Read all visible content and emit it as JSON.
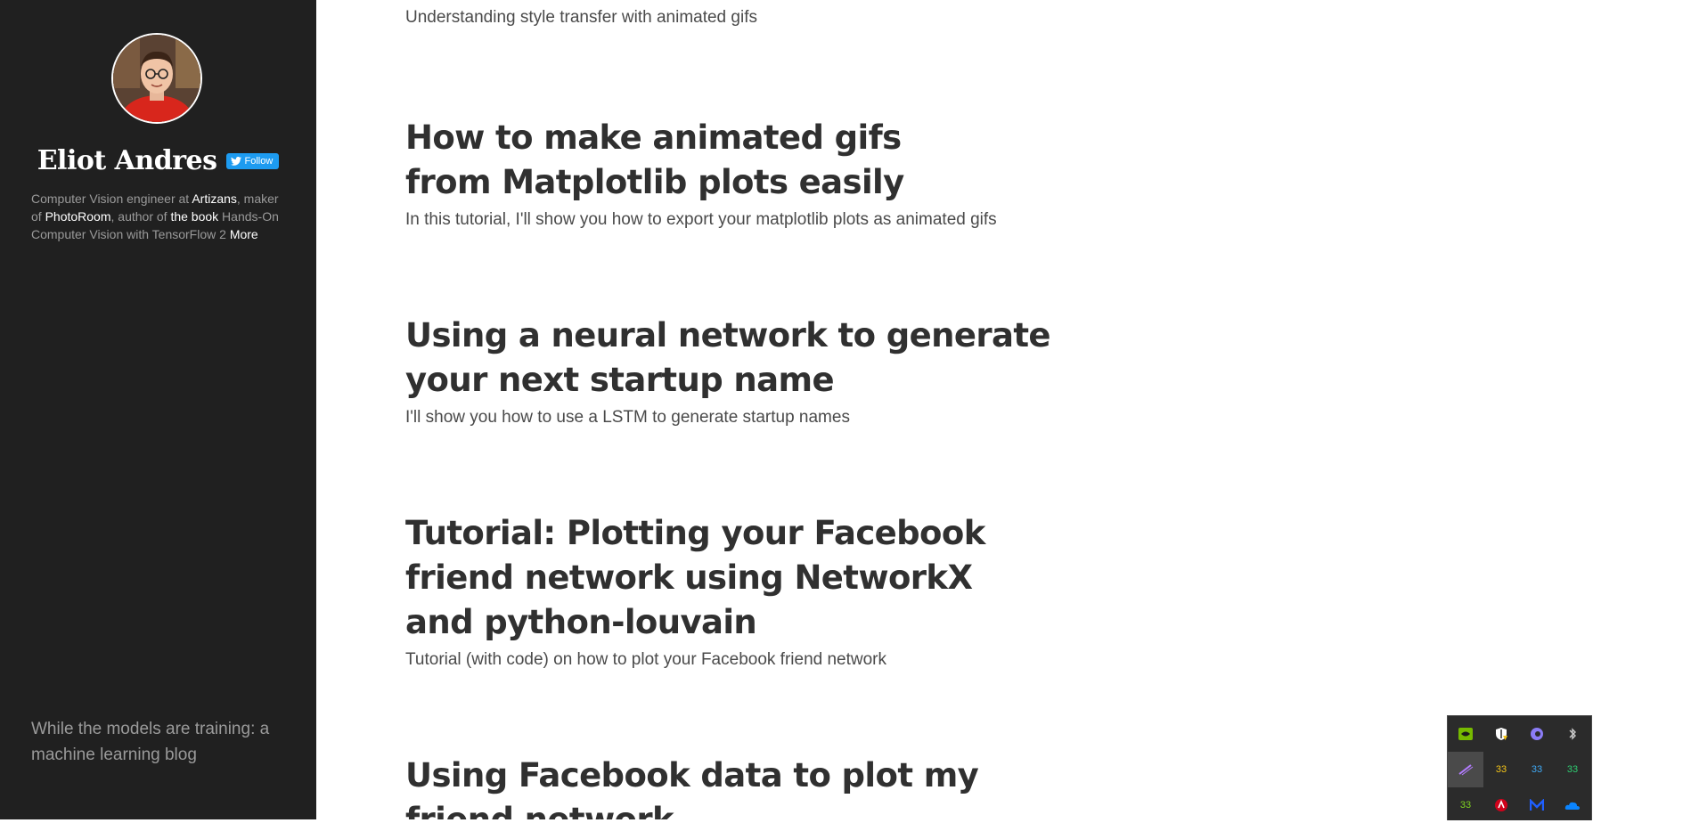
{
  "sidebar": {
    "author_name": "Eliot Andres",
    "follow_label": "Follow",
    "bio": {
      "p1": "Computer Vision engineer at ",
      "link1": "Artizans",
      "p2": ", maker of ",
      "link2": "PhotoRoom",
      "p3": ", author of ",
      "link3": "the book",
      "p4": " Hands-On Computer Vision with TensorFlow 2 ",
      "link4": "More"
    },
    "tagline": "While the models are training: a machine learning blog"
  },
  "posts": [
    {
      "title": "",
      "excerpt": "Understanding style transfer with animated gifs"
    },
    {
      "title": "How to make animated gifs from Matplotlib plots easily",
      "excerpt": "In this tutorial, I'll show you how to export your matplotlib plots as animated gifs"
    },
    {
      "title": "Using a neural network to generate your next startup name",
      "excerpt": "I'll show you how to use a LSTM to generate startup names"
    },
    {
      "title": "Tutorial: Plotting your Facebook friend network using NetworkX and python-louvain",
      "excerpt": "Tutorial (with code) on how to plot your Facebook friend network"
    },
    {
      "title": "Using Facebook data to plot my friend network",
      "excerpt": ""
    }
  ],
  "tray": {
    "icons": [
      {
        "name": "nvidia-icon",
        "label": "",
        "color": "#76b900"
      },
      {
        "name": "shield-warning-icon",
        "label": "",
        "color": "#ffffff"
      },
      {
        "name": "browser-icon",
        "label": "",
        "color": "#8b7cf6"
      },
      {
        "name": "bluetooth-icon",
        "label": "",
        "color": "#cccccc"
      },
      {
        "name": "pen-tablet-icon",
        "label": "",
        "color": "#b37cff"
      },
      {
        "name": "temperature-icon-1",
        "label": "33",
        "color": "#f5c518"
      },
      {
        "name": "temperature-icon-2",
        "label": "33",
        "color": "#3fa9f5"
      },
      {
        "name": "temperature-icon-3",
        "label": "33",
        "color": "#2ecc71"
      },
      {
        "name": "temperature-icon-4",
        "label": "33",
        "color": "#7ed321"
      },
      {
        "name": "antivirus-icon",
        "label": "",
        "color": "#d0021b"
      },
      {
        "name": "malwarebytes-icon",
        "label": "",
        "color": "#1f5fff"
      },
      {
        "name": "onedrive-icon",
        "label": "",
        "color": "#0a84ff"
      }
    ]
  }
}
